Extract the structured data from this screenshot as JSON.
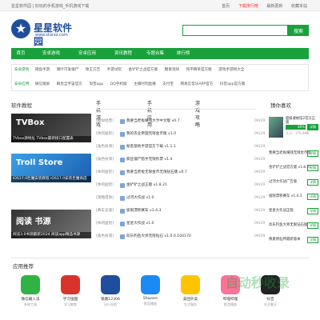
{
  "topbar": {
    "welcome": "星星软件园 | 好玩的手机游戏_手机游戏下载",
    "links": [
      "首页",
      "下载排行榜",
      "最新更新",
      "收藏本站"
    ]
  },
  "logo": {
    "name": "星星软件园",
    "url": "www.starxz.com"
  },
  "search": {
    "placeholder": "",
    "button": "搜索"
  },
  "nav": [
    "首页",
    "安卓游戏",
    "安卓应用",
    "资讯教程",
    "专题合集",
    "排行榜"
  ],
  "links_rows": [
    {
      "tag": "安卓游戏",
      "items": [
        "捕鱼手游",
        "啸叶可爱僵尸",
        "球王方吉",
        "手游试玩",
        "游戏工具",
        "游戏盒子",
        "金铲铲之战官方版",
        "糖果消除",
        "和平精英官方版",
        "游戏手游榜大全"
      ]
    },
    {
      "tag": "安卓应用",
      "items": [
        "微信锁屏",
        "瞬息全宇宙官方",
        "淘宝app",
        "QQ手机版",
        "主播时刻直播",
        "支付宝",
        "网易云音乐",
        "网易云音乐APP官方",
        "抖音app官方版"
      ]
    }
  ],
  "sections": {
    "software": "软件教程",
    "guess": "猜你喜欢",
    "apps": "应用推荐"
  },
  "tabs": [
    "手机游戏",
    "手机应用",
    "游戏攻略"
  ],
  "thumbs": [
    {
      "big": "TVBox",
      "cap": "TVbox源地址 TVbox最新接口配置表"
    },
    {
      "big": "Troll Store",
      "cap": "iOS17.0巨魔安装教程 iOS17.0安装巨魔商店"
    },
    {
      "big": "阅读 书源",
      "cap": "阅读3.0书源最新2024 阅读app精品书源"
    }
  ],
  "list": [
    {
      "cat": "[模拟经营]",
      "title": "我要当老板赚钱大亨中文版 v0.7",
      "date": "09/29"
    },
    {
      "cat": "[休闲益智]",
      "title": "我的农业帝国无限金币版 v1.0",
      "date": "09/29"
    },
    {
      "cat": "[角色扮演]",
      "title": "秘密基地手游官方下载 v1.1.1",
      "date": "09/29"
    },
    {
      "cat": "[角色扮演]",
      "title": "疯狂僵尸猎手无限钞票 v1.4",
      "date": "09/29"
    },
    {
      "cat": "[休闲益智]",
      "title": "我要当老板无限金币无限钻石版 v0.7",
      "date": "09/29"
    },
    {
      "cat": "[休闲益智]",
      "title": "金铲铲之战正版 v1.8.21",
      "date": "09/29"
    },
    {
      "cat": "[策略塔防]",
      "title": "过河大作战 v1.0",
      "date": "09/29"
    },
    {
      "cat": "[赛车竞速]",
      "title": "极限漂移赛车 v1.4.3",
      "date": "09/29"
    },
    {
      "cat": "[休闲益智]",
      "title": "星星大作战 v1.0",
      "date": "09/29"
    },
    {
      "cat": "[角色扮演]",
      "title": "欢乐钓鱼大师无限钻石 v1.0.0.104170",
      "date": "09/29"
    }
  ],
  "guess": {
    "featured": {
      "title": "超级收纳馆2官方正版",
      "meta": "大小：176.4MB",
      "percent": "80%",
      "btn": "详情"
    },
    "rows": [
      {
        "t": "我要当老板赚钱无限金币版",
        "b": "详情"
      },
      {
        "t": "金铲铲之战官方版 v1.8.21",
        "b": "详情"
      },
      {
        "t": "过河大作战广告版",
        "b": "详情"
      },
      {
        "t": "极限漂移赛车 v1.4.3",
        "b": "详情"
      },
      {
        "t": "星星大作战正版",
        "b": "详情"
      },
      {
        "t": "欢乐钓鱼大师无限钻石版",
        "b": "详情"
      },
      {
        "t": "像素修仙传最新版本",
        "b": "详情"
      }
    ]
  },
  "apps": [
    {
      "name": "微信输入法",
      "type": "系统工具",
      "color": "#2fb344"
    },
    {
      "name": "学习强国",
      "type": "学习教育",
      "color": "#d9342b"
    },
    {
      "name": "铁路12306",
      "type": "出行导航",
      "color": "#1f4e9c"
    },
    {
      "name": "Shazam",
      "type": "影音播放",
      "color": "#1b8af5"
    },
    {
      "name": "美团外卖",
      "type": "生活服务",
      "color": "#ffc300"
    },
    {
      "name": "哔哩哔哩",
      "type": "影音播放",
      "color": "#fb7299"
    },
    {
      "name": "抖音",
      "type": "社交聊天",
      "color": "#222222"
    }
  ],
  "watermark": "自动秒收录"
}
